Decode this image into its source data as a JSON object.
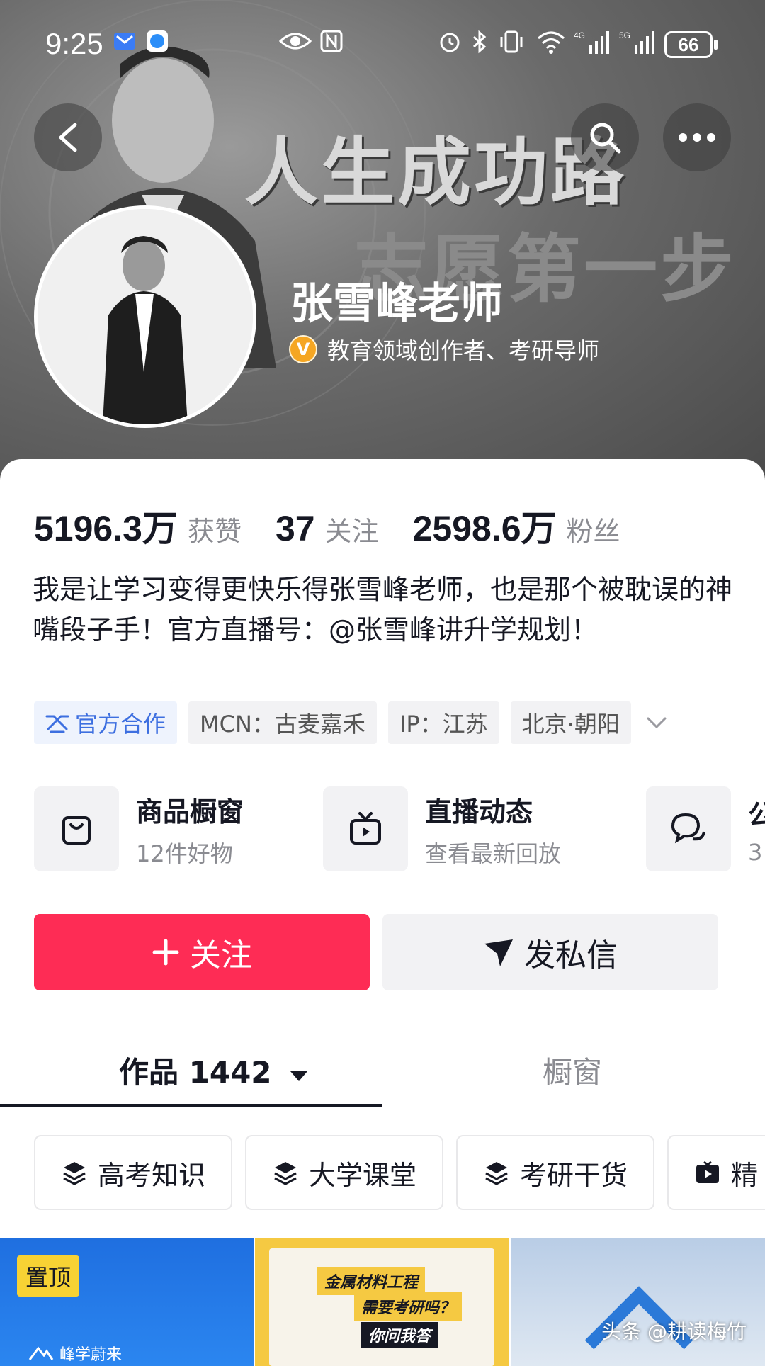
{
  "status_bar": {
    "time": "9:25",
    "battery": "66"
  },
  "banner": {
    "line1": "人生成功路",
    "line2": "志愿第一步"
  },
  "profile": {
    "name": "张雪峰老师",
    "verified_badge": "V",
    "verification": "教育领域创作者、考研导师"
  },
  "stats": [
    {
      "value": "5196.3万",
      "label": "获赞"
    },
    {
      "value": "37",
      "label": "关注"
    },
    {
      "value": "2598.6万",
      "label": "粉丝"
    }
  ],
  "bio": "我是让学习变得更快乐得张雪峰老师，也是那个被耽误的神嘴段子手！官方直播号：@张雪峰讲升学规划！",
  "tags": [
    {
      "label": "官方合作",
      "icon": "handshake-icon"
    },
    {
      "label": "MCN：古麦嘉禾"
    },
    {
      "label": "IP：江苏"
    },
    {
      "label": "北京·朝阳"
    }
  ],
  "services": [
    {
      "title": "商品橱窗",
      "sub": "12件好物",
      "icon": "shopping-bag-icon"
    },
    {
      "title": "直播动态",
      "sub": "查看最新回放",
      "icon": "tv-icon"
    },
    {
      "title": "公",
      "sub": "3",
      "icon": "chat-icon"
    }
  ],
  "actions": {
    "follow": "关注",
    "message": "发私信"
  },
  "tabs": {
    "works": "作品 1442",
    "shop": "橱窗"
  },
  "collections": [
    "高考知识",
    "大学课堂",
    "考研干货",
    "精"
  ],
  "thumbnails": {
    "pin_label": "置顶",
    "t1_brand": "峰学蔚来",
    "t2_line1": "金属材料工程",
    "t2_line2": "需要考研吗？",
    "t2_line3": "你问我答"
  },
  "watermark": "头条 @耕读梅竹",
  "colors": {
    "accent": "#fe2c55",
    "official_blue": "#3d6fe0",
    "verify_gold": "#f5a623"
  }
}
